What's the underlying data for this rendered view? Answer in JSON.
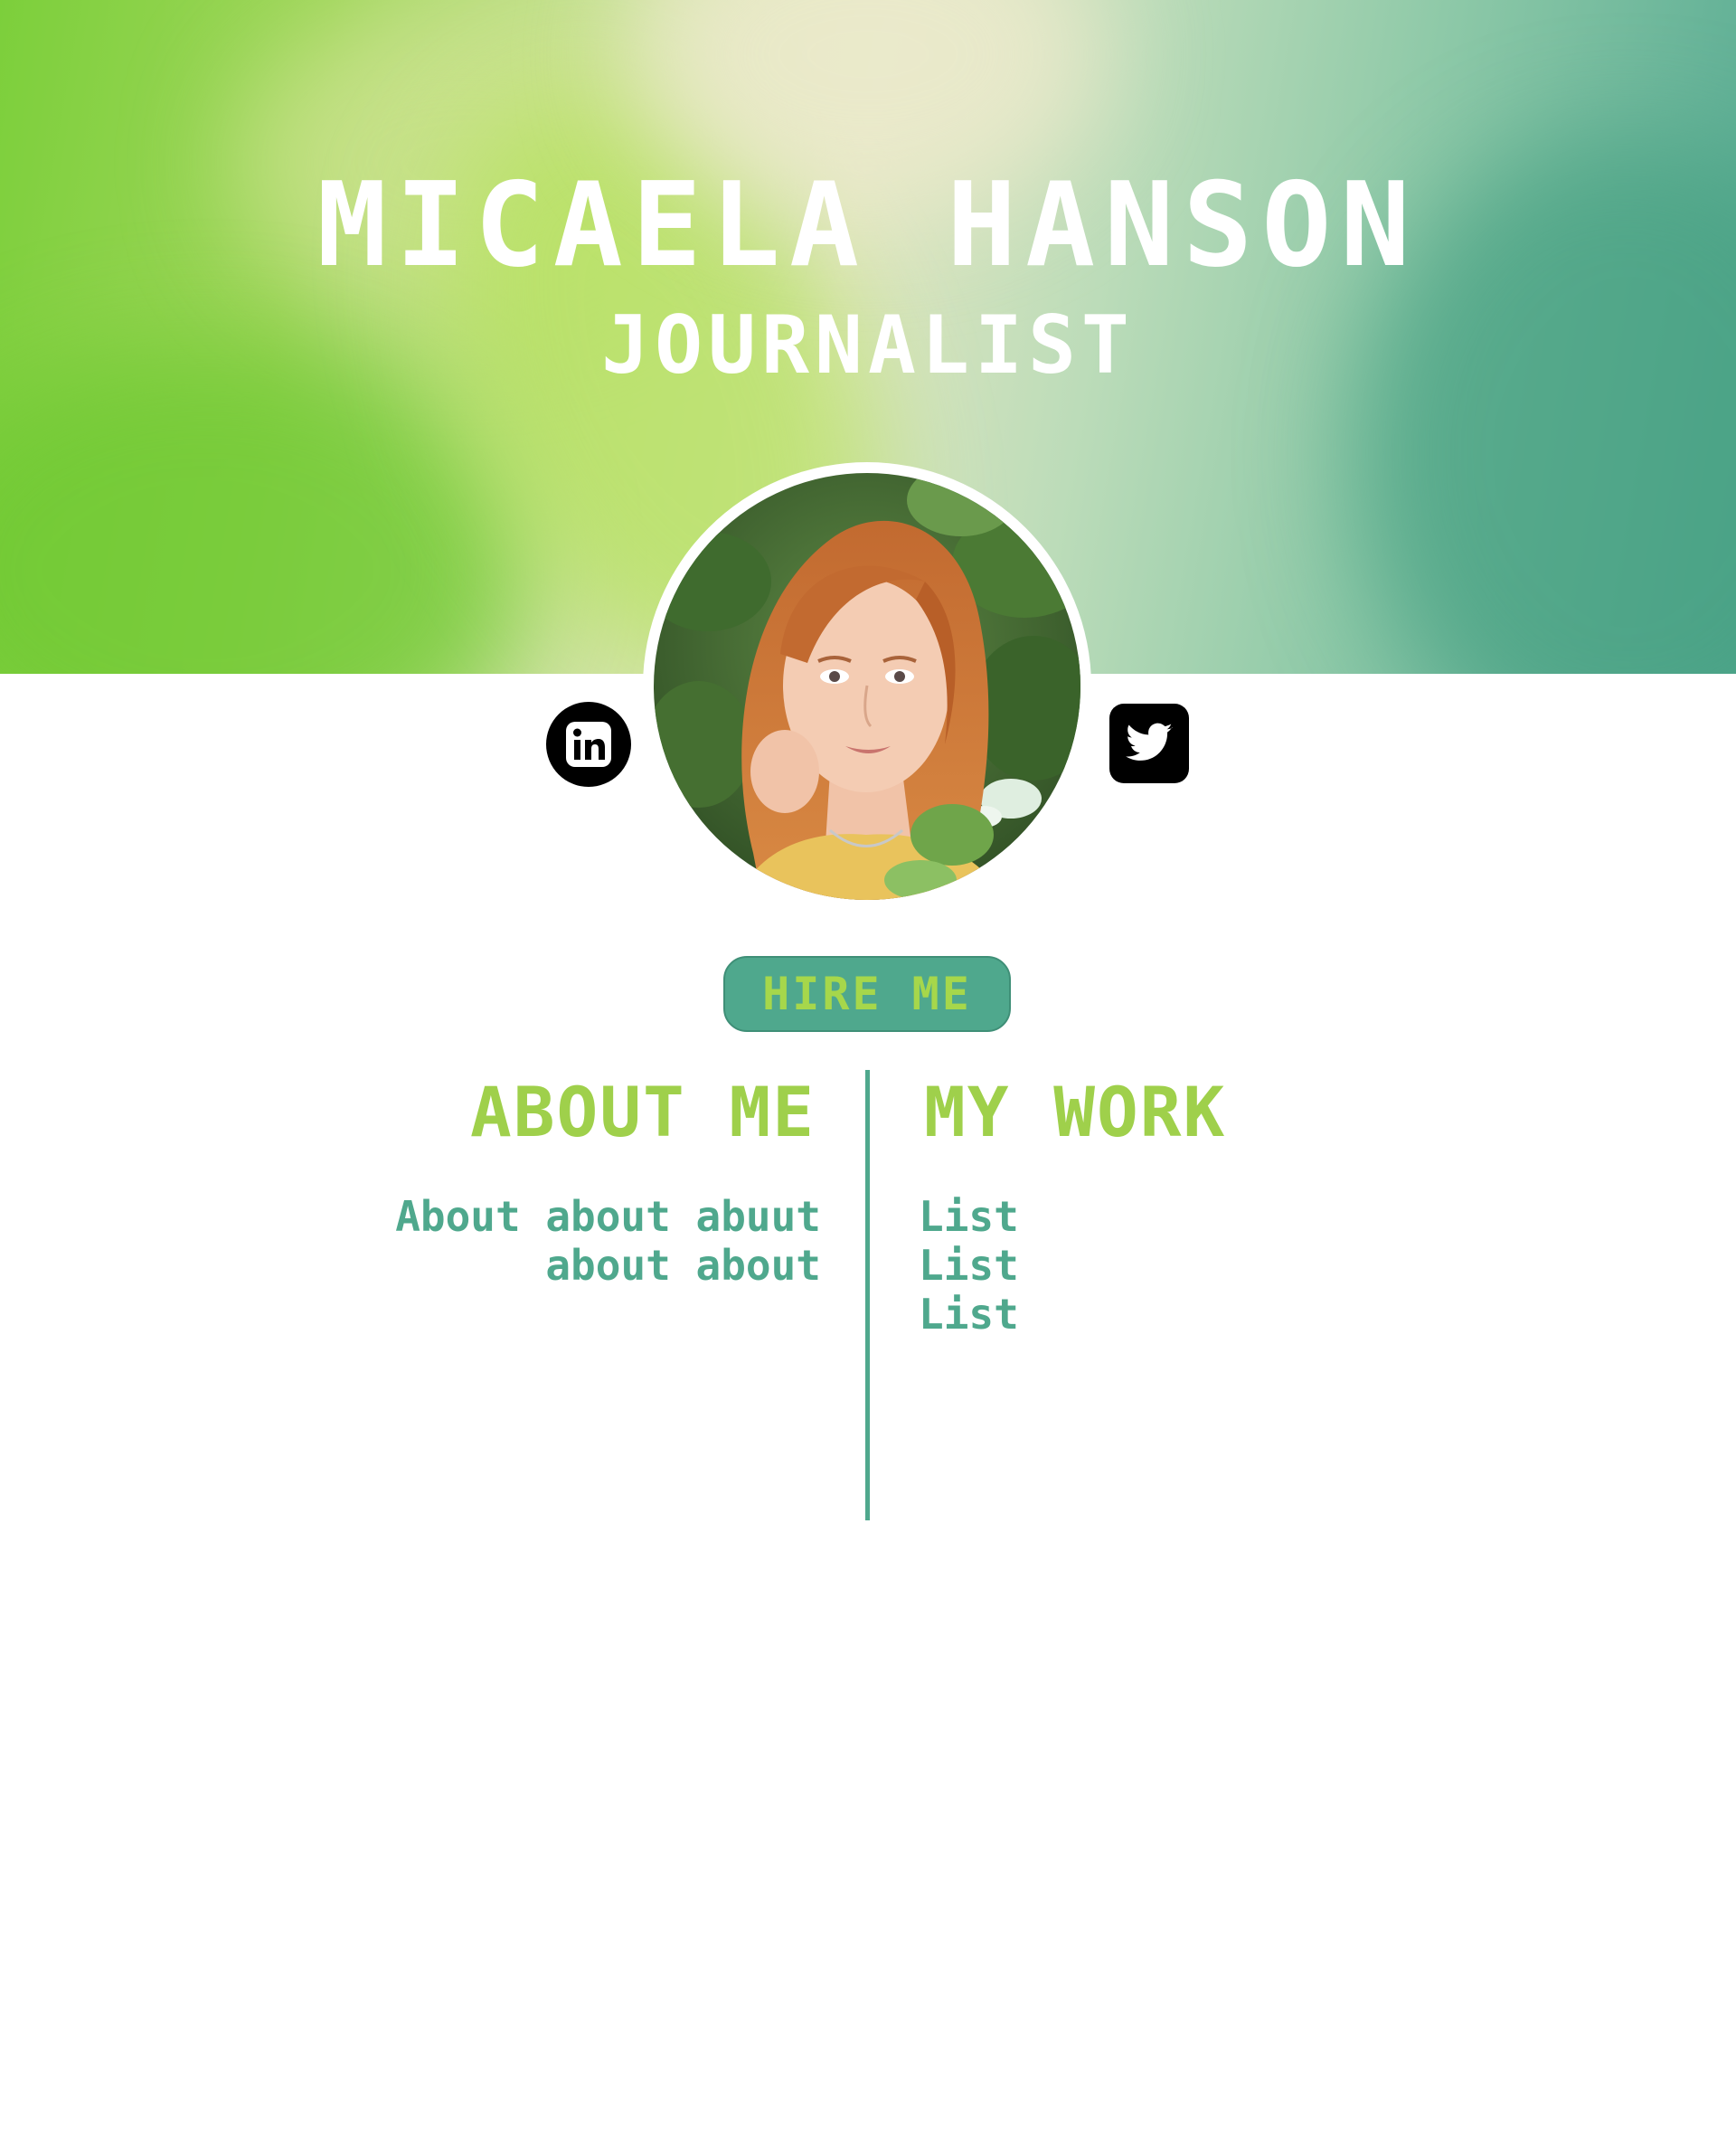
{
  "header": {
    "name": "MICAELA HANSON",
    "title": "JOURNALIST"
  },
  "profile": {
    "avatar_icon": "profile-photo"
  },
  "social": {
    "linkedin_icon": "linkedin-icon",
    "twitter_icon": "twitter-icon"
  },
  "cta": {
    "hire_label": "HIRE ME"
  },
  "about": {
    "heading": "ABOUT ME",
    "lines": [
      "About about abuut",
      "about about"
    ]
  },
  "work": {
    "heading": "MY WORK",
    "items": [
      "List",
      "List",
      "List"
    ]
  },
  "colors": {
    "accent_teal": "#4fa88d",
    "accent_green": "#9fd04b",
    "hero_green": "#7ccf3b"
  }
}
